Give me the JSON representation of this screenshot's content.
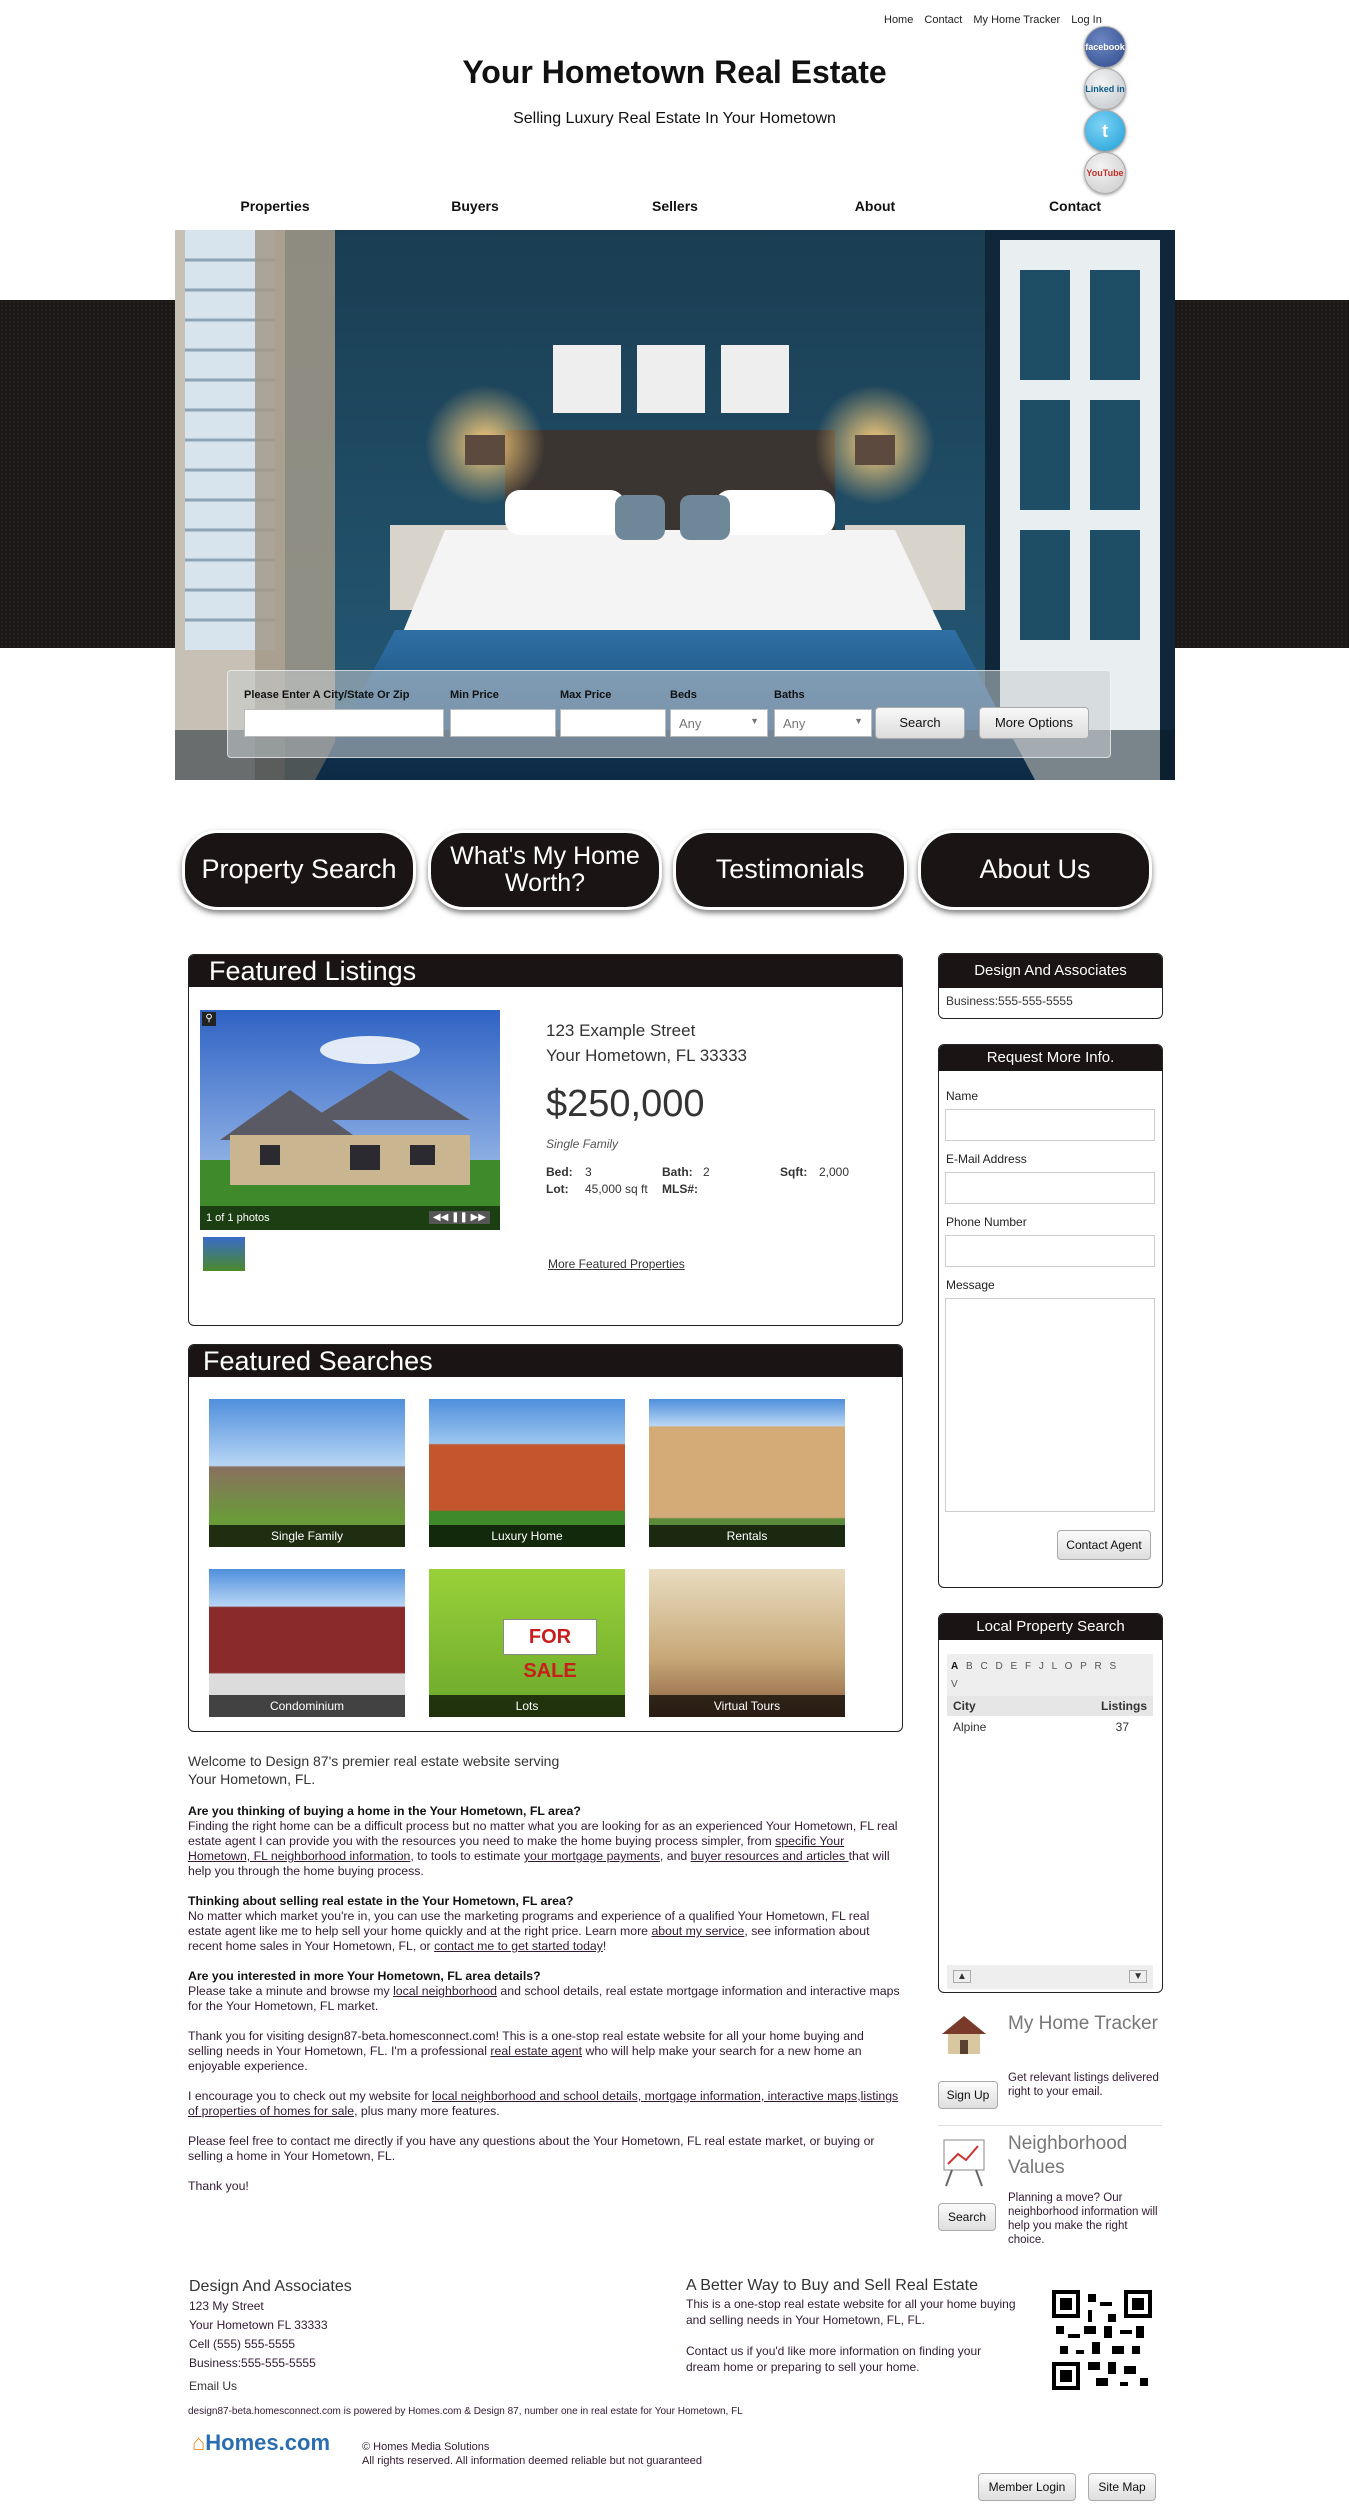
{
  "top_links": [
    "Home",
    "Contact",
    "My Home Tracker",
    "Log In"
  ],
  "social": [
    "facebook",
    "Linked in",
    "twitter",
    "YouTube"
  ],
  "site": {
    "title": "Your Hometown Real Estate",
    "subtitle": "Selling Luxury Real Estate In Your Hometown"
  },
  "nav": [
    "Properties",
    "Buyers",
    "Sellers",
    "About",
    "Contact"
  ],
  "search": {
    "city_label": "Please Enter A City/State Or Zip",
    "min_label": "Min Price",
    "max_label": "Max Price",
    "beds_label": "Beds",
    "baths_label": "Baths",
    "beds_value": "Any",
    "baths_value": "Any",
    "search_btn": "Search",
    "more_btn": "More Options"
  },
  "pills": [
    "Property Search",
    "What's My Home Worth?",
    "Testimonials",
    "About Us"
  ],
  "featured": {
    "title": "Featured Listings",
    "address1": "123 Example Street",
    "address2": "Your Hometown, FL 33333",
    "price": "$250,000",
    "type": "Single Family",
    "bed_label": "Bed:",
    "bed": "3",
    "bath_label": "Bath:",
    "bath": "2",
    "sqft_label": "Sqft:",
    "sqft": "2,000",
    "lot_label": "Lot:",
    "lot": "45,000 sq ft",
    "mls_label": "MLS#:",
    "photo_count": "1 of 1 photos",
    "more_link": "More Featured Properties"
  },
  "featured_searches": {
    "title": "Featured Searches",
    "tiles": [
      "Single Family",
      "Luxury Home",
      "Rentals",
      "Condominium",
      "Lots",
      "Virtual Tours"
    ]
  },
  "body": {
    "welcome": "Welcome to Design 87's premier real estate website serving Your Hometown, FL.",
    "q1": "Are you thinking of buying a home in the Your Hometown, FL area?",
    "p1a": "Finding the right home can be a difficult process but no matter what you are looking for as an experienced Your Hometown, FL real estate agent I can provide you with the resources you need to make the home buying process simpler, from ",
    "p1l1": "specific Your Hometown, FL neighborhood information",
    "p1b": ", to tools to estimate ",
    "p1l2": "your mortgage payments",
    "p1c": ", and ",
    "p1l3": "buyer resources and articles ",
    "p1d": "that will help you through the home buying process.",
    "q2": "Thinking about selling real estate in the Your Hometown, FL area?",
    "p2a": "No matter which market you're in, you can use the marketing programs and experience of a qualified Your Hometown, FL real estate agent like me to help sell your home quickly and at the right price. Learn more ",
    "p2l1": "about my service",
    "p2b": ", see information about recent home sales in Your Hometown, FL, or ",
    "p2l2": "contact me to get started today",
    "p2c": "!",
    "q3": "Are you interested in more Your Hometown, FL area details?",
    "p3a": "Please take a minute and browse my ",
    "p3l1": "local neighborhood",
    "p3b": " and school details, real estate mortgage information and interactive maps for the Your Hometown, FL market.",
    "p4a": "Thank you for visiting design87-beta.homesconnect.com! This is a one-stop real estate website for all your home buying and selling needs in Your Hometown, FL. I'm a professional ",
    "p4l1": "real estate agent",
    "p4b": " who will help make your search for a new home an enjoyable experience.",
    "p5a": "I encourage you to check out my website for ",
    "p5l1": "local neighborhood and school details, mortgage information, interactive maps,listings of properties of homes for sale",
    "p5b": ", plus many more features.",
    "p6": "Please feel free to contact me directly if you have any questions about the Your Hometown, FL real estate market, or buying or selling a home in Your Hometown, FL.",
    "p7": "Thank you!"
  },
  "sidebar": {
    "agent_title": "Design And Associates",
    "agent_phone": "Business:555-555-5555",
    "request_title": "Request More Info.",
    "name_label": "Name",
    "email_label": "E-Mail Address",
    "phone_label": "Phone Number",
    "message_label": "Message",
    "contact_btn": "Contact Agent",
    "local_title": "Local Property Search",
    "letters": [
      "A",
      "B",
      "C",
      "D",
      "E",
      "F",
      "J",
      "L",
      "O",
      "P",
      "R",
      "S",
      "V"
    ],
    "col_city": "City",
    "col_listings": "Listings",
    "rows": [
      {
        "city": "Alpine",
        "count": "37"
      }
    ],
    "tracker_title": "My Home Tracker",
    "tracker_text": "Get relevant listings delivered right to your email.",
    "tracker_btn": "Sign Up",
    "values_title": "Neighborhood Values",
    "values_text": "Planning a move? Our neighborhood information will help you make the right choice.",
    "values_btn": "Search"
  },
  "footer": {
    "company": "Design And Associates",
    "street": "123 My Street",
    "city": "Your Hometown FL 33333",
    "cell": "Cell (555) 555-5555",
    "business": "Business:555-555-5555",
    "email": "Email Us",
    "tagline": "A Better Way to Buy and Sell Real Estate",
    "tag_p1": "This is a one-stop real estate website for all your home buying and selling needs in Your Hometown, FL, FL.",
    "tag_p2": "Contact us if you'd like more information on finding your dream home or preparing to sell your home.",
    "powered": "design87-beta.homesconnect.com is powered by Homes.com & Design 87, number one in real estate for Your Hometown, FL",
    "logo": "Homes.com",
    "copyright": "© Homes Media Solutions",
    "rights": "All rights reserved. All information deemed reliable but not guaranteed",
    "member_btn": "Member Login",
    "sitemap_btn": "Site Map"
  }
}
